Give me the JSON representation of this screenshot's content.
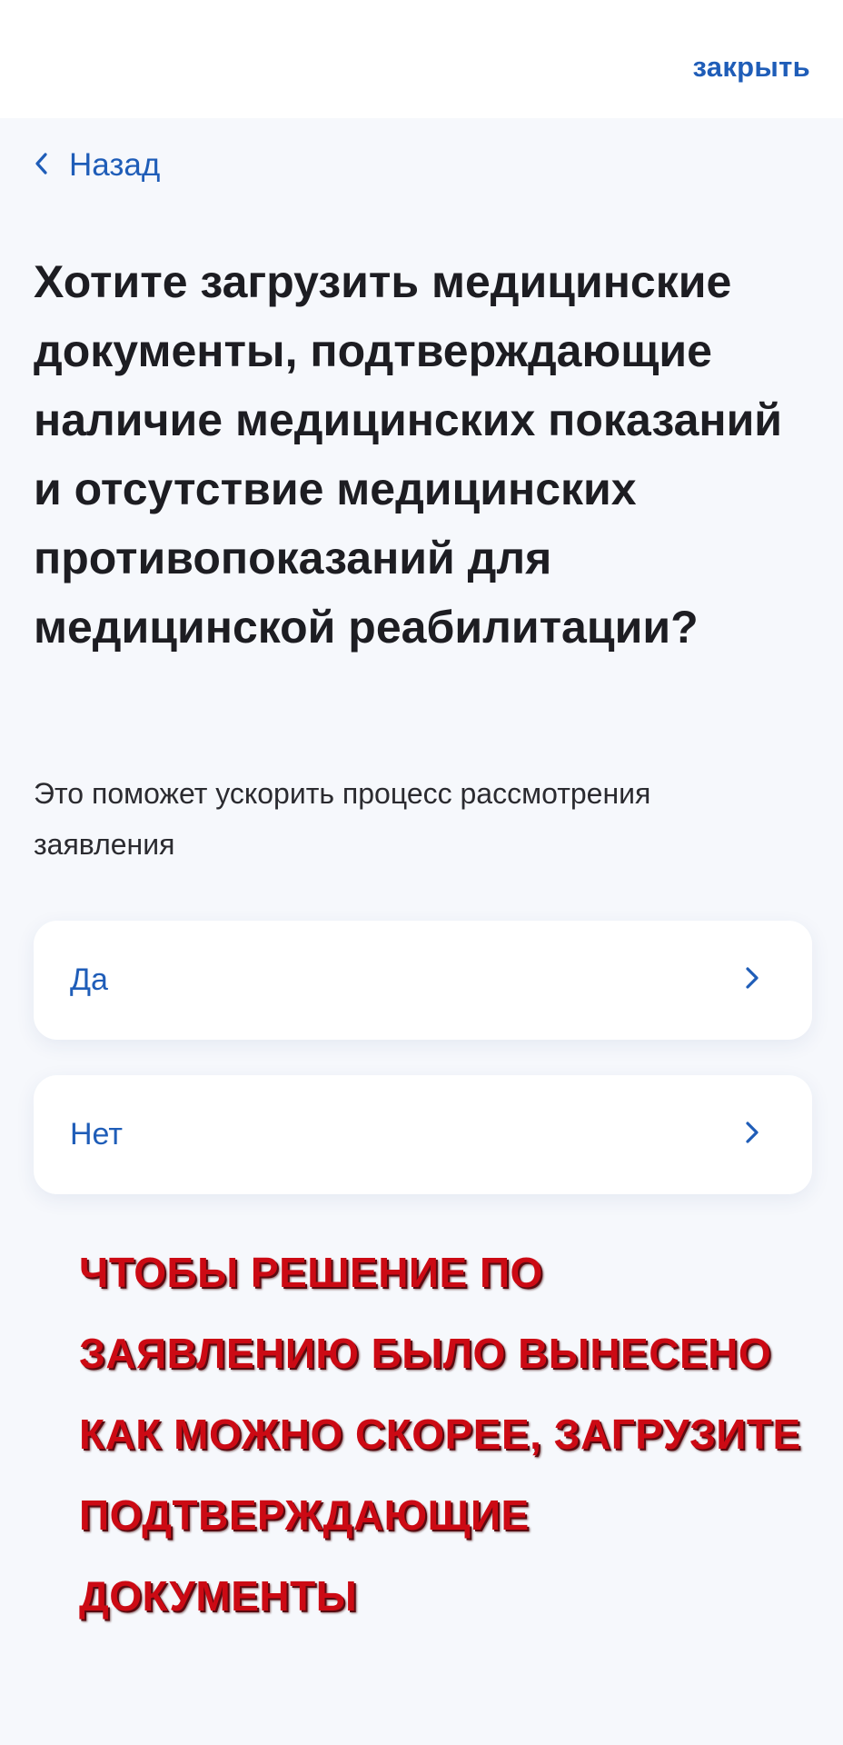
{
  "header": {
    "close_label": "закрыть"
  },
  "nav": {
    "back_label": "Назад"
  },
  "question": {
    "title": "Хотите загрузить медицинские документы, подтверждающие наличие медицинских показаний и отсутствие медицинских противопоказаний для медицинской реабилитации?",
    "subtitle": "Это поможет ускорить процесс рассмотрения заявления"
  },
  "options": [
    {
      "label": "Да",
      "icon": "chevron-right-icon"
    },
    {
      "label": "Нет",
      "icon": "chevron-right-icon"
    }
  ],
  "notice": {
    "text": "ЧТОБЫ РЕШЕНИЕ ПО ЗАЯВЛЕНИЮ БЫЛО ВЫНЕСЕНО КАК МОЖНО СКОРЕЕ, ЗАГРУЗИТЕ ПОДТВЕРЖДАЮЩИЕ ДОКУМЕНТЫ"
  },
  "colors": {
    "accent": "#1f5db8",
    "background": "#f6f8fc",
    "notice": "#cc0a14"
  }
}
